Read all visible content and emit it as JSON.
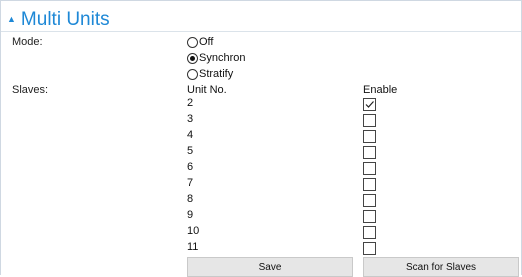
{
  "section": {
    "title": "Multi Units",
    "caret": "▲"
  },
  "mode": {
    "label": "Mode:",
    "options": [
      {
        "label": "Off",
        "selected": false
      },
      {
        "label": "Synchron",
        "selected": true
      },
      {
        "label": "Stratify",
        "selected": false
      }
    ]
  },
  "slaves": {
    "label": "Slaves:",
    "unit_header": "Unit No.",
    "enable_header": "Enable",
    "rows": [
      {
        "unit": "2",
        "enabled": true
      },
      {
        "unit": "3",
        "enabled": false
      },
      {
        "unit": "4",
        "enabled": false
      },
      {
        "unit": "5",
        "enabled": false
      },
      {
        "unit": "6",
        "enabled": false
      },
      {
        "unit": "7",
        "enabled": false
      },
      {
        "unit": "8",
        "enabled": false
      },
      {
        "unit": "9",
        "enabled": false
      },
      {
        "unit": "10",
        "enabled": false
      },
      {
        "unit": "11",
        "enabled": false
      }
    ]
  },
  "buttons": {
    "save": "Save",
    "scan": "Scan for Slaves"
  },
  "colors": {
    "accent": "#1e88d6",
    "button_bg": "#e6e6e6"
  }
}
